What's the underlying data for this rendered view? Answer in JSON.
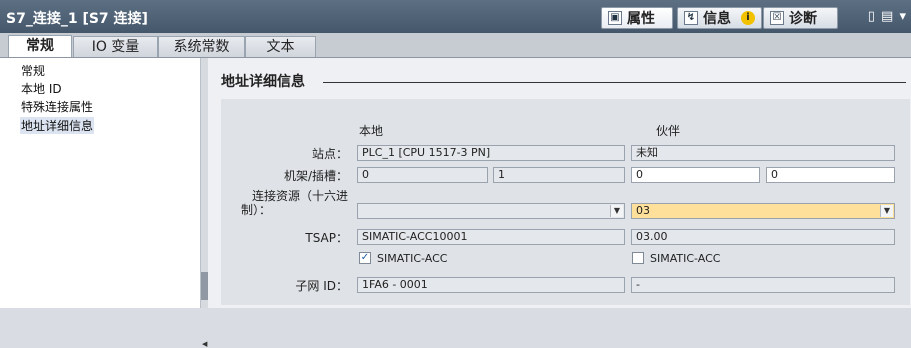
{
  "window": {
    "title": "S7_连接_1 [S7 连接]",
    "controls": "▯ ▤ ▾"
  },
  "panel_tabs": [
    {
      "label": "属性",
      "icon": "properties-icon",
      "glyph": "▣",
      "active": true
    },
    {
      "label": "信息",
      "icon": "info-icon",
      "glyph": "↯",
      "badge": "i",
      "active": false
    },
    {
      "label": "诊断",
      "icon": "diagnostics-icon",
      "glyph": "☒",
      "active": false
    }
  ],
  "sub_tabs": [
    {
      "label": "常规",
      "active": true
    },
    {
      "label": "IO 变量",
      "active": false
    },
    {
      "label": "系统常数",
      "active": false
    },
    {
      "label": "文本",
      "active": false
    }
  ],
  "nav": {
    "items": [
      {
        "label": "常规",
        "selected": false
      },
      {
        "label": "本地 ID",
        "selected": false
      },
      {
        "label": "特殊连接属性",
        "selected": false
      },
      {
        "label": "地址详细信息",
        "selected": true
      }
    ]
  },
  "section": {
    "title": "地址详细信息",
    "columns": {
      "local": "本地",
      "partner": "伙伴"
    },
    "station": {
      "label": "站点：",
      "local": "PLC_1 [CPU 1517-3 PN]",
      "partner": "未知"
    },
    "rack_slot": {
      "label": "机架/插槽：",
      "local_rack": "0",
      "local_slot": "1",
      "partner_rack": "0",
      "partner_slot": "0"
    },
    "conn_resource": {
      "label_line1": "连接资源（十六进",
      "label_line2": "制）：",
      "local": "",
      "partner": "03"
    },
    "tsap": {
      "label": "TSAP：",
      "local": "SIMATIC-ACC10001",
      "partner": "03.00"
    },
    "simatic_acc": {
      "local_label": "SIMATIC-ACC",
      "local_checked": true,
      "partner_label": "SIMATIC-ACC",
      "partner_checked": false
    },
    "subnet_id": {
      "label": "子网 ID：",
      "local": "1FA6 - 0001",
      "partner": "-"
    }
  },
  "colors": {
    "title_bar": "#4e6175",
    "highlight_field": "#ffe09a",
    "selected_nav": "#dbe4f0"
  }
}
